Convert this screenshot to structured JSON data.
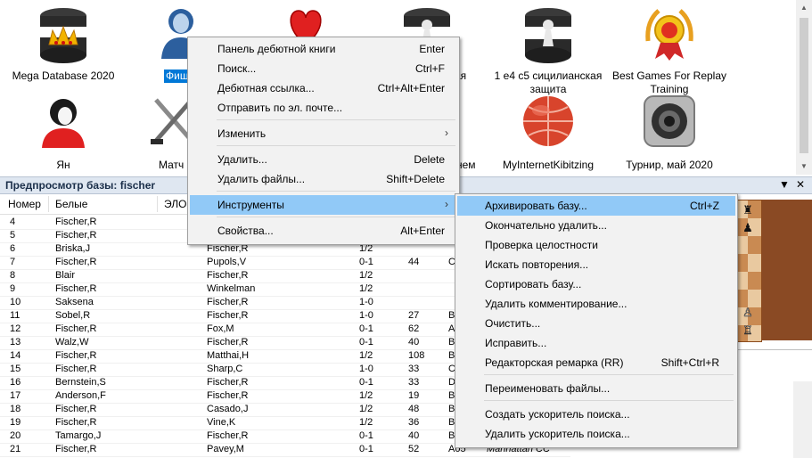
{
  "databases": [
    {
      "label": "Mega Database 2020",
      "icon": "database-crown-icon"
    },
    {
      "label": "Фишер",
      "icon": "user-avatar-icon",
      "selected": true
    },
    {
      "label": "",
      "icon": "heart-icon"
    },
    {
      "label": "...ая",
      "icon": "database-pawn-icon"
    },
    {
      "label": "1 e4 c5 сицилианская защита",
      "icon": "database-pawn-icon"
    },
    {
      "label": "Best Games For Replay Training",
      "icon": "medal-icon"
    },
    {
      "label": "Ян",
      "icon": "user-avatar-icon"
    },
    {
      "label": "Матч",
      "icon": "crossed-swords-icon"
    },
    {
      "label": "...нем",
      "icon": "database-icon"
    },
    {
      "label": "MyInternetKibitzing",
      "icon": "globe-icon"
    },
    {
      "label": "Турнир, май 2020",
      "icon": "tournament-icon"
    }
  ],
  "preview": {
    "title": "Предпросмотр базы: fischer",
    "dropdown_glyph": "▼",
    "close_glyph": "✕"
  },
  "table": {
    "headers": {
      "num": "Номер",
      "white": "Белые",
      "elo": "ЭЛО"
    },
    "rows": [
      {
        "num": "4",
        "white": "Fischer,R",
        "black": "",
        "res": "",
        "moves": "",
        "eco": "",
        "event": ""
      },
      {
        "num": "5",
        "white": "Fischer,R",
        "black": "",
        "res": "",
        "moves": "",
        "eco": "",
        "event": ""
      },
      {
        "num": "6",
        "white": "Briska,J",
        "black": "Fischer,R",
        "res": "1/2",
        "moves": "",
        "eco": "",
        "event": ""
      },
      {
        "num": "7",
        "white": "Fischer,R",
        "black": "Pupols,V",
        "res": "0-1",
        "moves": "44",
        "eco": "C",
        "event": ""
      },
      {
        "num": "8",
        "white": "Blair",
        "black": "Fischer,R",
        "res": "1/2",
        "moves": "",
        "eco": "",
        "event": ""
      },
      {
        "num": "9",
        "white": "Fischer,R",
        "black": "Winkelman",
        "res": "1/2",
        "moves": "",
        "eco": "",
        "event": ""
      },
      {
        "num": "10",
        "white": "Saksena",
        "black": "Fischer,R",
        "res": "1-0",
        "moves": "",
        "eco": "",
        "event": ""
      },
      {
        "num": "11",
        "white": "Sobel,R",
        "black": "Fischer,R",
        "res": "1-0",
        "moves": "27",
        "eco": "B",
        "event": ""
      },
      {
        "num": "12",
        "white": "Fischer,R",
        "black": "Fox,M",
        "res": "0-1",
        "moves": "62",
        "eco": "A",
        "event": ""
      },
      {
        "num": "13",
        "white": "Walz,W",
        "black": "Fischer,R",
        "res": "0-1",
        "moves": "40",
        "eco": "B",
        "event": ""
      },
      {
        "num": "14",
        "white": "Fischer,R",
        "black": "Matthai,H",
        "res": "1/2",
        "moves": "108",
        "eco": "B",
        "event": ""
      },
      {
        "num": "15",
        "white": "Fischer,R",
        "black": "Sharp,C",
        "res": "1-0",
        "moves": "33",
        "eco": "C",
        "event": ""
      },
      {
        "num": "16",
        "white": "Bernstein,S",
        "black": "Fischer,R",
        "res": "0-1",
        "moves": "33",
        "eco": "D",
        "event": ""
      },
      {
        "num": "17",
        "white": "Anderson,F",
        "black": "Fischer,R",
        "res": "1/2",
        "moves": "19",
        "eco": "B",
        "event": ""
      },
      {
        "num": "18",
        "white": "Fischer,R",
        "black": "Casado,J",
        "res": "1/2",
        "moves": "48",
        "eco": "B",
        "event": ""
      },
      {
        "num": "19",
        "white": "Fischer,R",
        "black": "Vine,K",
        "res": "1/2",
        "moves": "36",
        "eco": "B",
        "event": ""
      },
      {
        "num": "20",
        "white": "Tamargo,J",
        "black": "Fischer,R",
        "res": "0-1",
        "moves": "40",
        "eco": "B",
        "event": ""
      },
      {
        "num": "21",
        "white": "Fischer,R",
        "black": "Pavey,M",
        "res": "0-1",
        "moves": "52",
        "eco": "A05",
        "event": "Manhattan CC"
      }
    ]
  },
  "context_menu": {
    "items": [
      {
        "label": "Панель дебютной книги",
        "shortcut": "Enter"
      },
      {
        "label": "Поиск...",
        "shortcut": "Ctrl+F"
      },
      {
        "label": "Дебютная ссылка...",
        "shortcut": "Ctrl+Alt+Enter"
      },
      {
        "label": "Отправить по эл. почте...",
        "shortcut": ""
      },
      {
        "label": "Изменить",
        "shortcut": "",
        "submenu": true
      },
      {
        "label": "Удалить...",
        "shortcut": "Delete"
      },
      {
        "label": "Удалить файлы...",
        "shortcut": "Shift+Delete"
      },
      {
        "label": "Инструменты",
        "shortcut": "",
        "submenu": true,
        "highlighted": true
      },
      {
        "label": "Свойства...",
        "shortcut": "Alt+Enter"
      }
    ],
    "submenu_glyph": "›"
  },
  "tools_submenu": {
    "items": [
      {
        "label": "Архивировать базу...",
        "shortcut": "Ctrl+Z",
        "highlighted": true
      },
      {
        "label": "Окончательно удалить...",
        "shortcut": ""
      },
      {
        "label": "Проверка целостности",
        "shortcut": ""
      },
      {
        "label": "Искать повторения...",
        "shortcut": ""
      },
      {
        "label": "Сортировать базу...",
        "shortcut": ""
      },
      {
        "label": "Удалить комментирование...",
        "shortcut": ""
      },
      {
        "label": "Очистить...",
        "shortcut": ""
      },
      {
        "label": "Исправить...",
        "shortcut": ""
      },
      {
        "label": "Редакторская ремарка (RR)",
        "shortcut": "Shift+Ctrl+R"
      },
      {
        "label": "Переименовать файлы...",
        "shortcut": ""
      },
      {
        "label": "Создать ускоритель поиска...",
        "shortcut": ""
      },
      {
        "label": "Удалить ускоритель поиска...",
        "shortcut": ""
      }
    ]
  },
  "colors": {
    "selection": "#0078d7",
    "menu_highlight": "#91c9f7",
    "menu_bg": "#f2f2f2",
    "header_bg": "#dfe7f1"
  }
}
